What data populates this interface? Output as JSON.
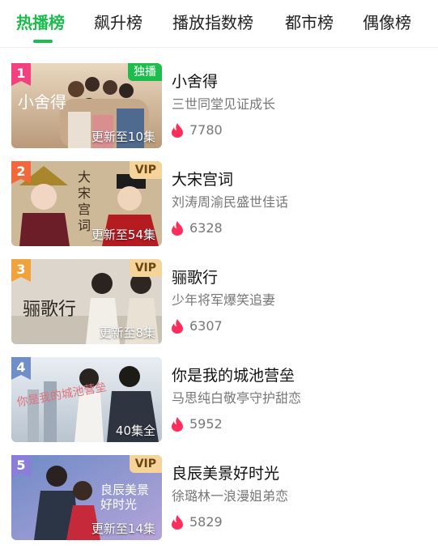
{
  "tabs": [
    {
      "label": "热播榜",
      "active": true
    },
    {
      "label": "飙升榜",
      "active": false
    },
    {
      "label": "播放指数榜",
      "active": false
    },
    {
      "label": "都市榜",
      "active": false
    },
    {
      "label": "偶像榜",
      "active": false
    }
  ],
  "colors": {
    "accent": "#1cbd4d",
    "flame": "#ff2d5c",
    "rank_1": "#f3407f",
    "rank_2": "#f2683a",
    "rank_3": "#f0a23b",
    "rank_4": "#6f8fc8",
    "rank_5": "#8b7ed8",
    "vip_badge": "#f4d49b"
  },
  "items": [
    {
      "rank": "1",
      "badge": "独播",
      "badge_type": "exclusive",
      "episodes": "更新至10集",
      "poster_logo": "小舍得",
      "title": "小舍得",
      "subtitle": "三世同堂见证成长",
      "heat": "7780",
      "heat_icon": "flame-icon"
    },
    {
      "rank": "2",
      "badge": "VIP",
      "badge_type": "vip",
      "episodes": "更新至54集",
      "poster_logo": "大宋宫词",
      "title": "大宋宫词",
      "subtitle": "刘涛周渝民盛世佳话",
      "heat": "6328",
      "heat_icon": "flame-icon"
    },
    {
      "rank": "3",
      "badge": "VIP",
      "badge_type": "vip",
      "episodes": "更新至8集",
      "poster_logo": "骊歌行",
      "title": "骊歌行",
      "subtitle": "少年将军爆笑追妻",
      "heat": "6307",
      "heat_icon": "flame-icon"
    },
    {
      "rank": "4",
      "badge": "",
      "badge_type": "none",
      "episodes": "40集全",
      "poster_logo": "你是我的城池营垒",
      "title": "你是我的城池营垒",
      "subtitle": "马思纯白敬亭守护甜恋",
      "heat": "5952",
      "heat_icon": "flame-icon"
    },
    {
      "rank": "5",
      "badge": "VIP",
      "badge_type": "vip",
      "episodes": "更新至14集",
      "poster_logo": "良辰美景好时光",
      "title": "良辰美景好时光",
      "subtitle": "徐璐林一浪漫姐弟恋",
      "heat": "5829",
      "heat_icon": "flame-icon"
    }
  ]
}
